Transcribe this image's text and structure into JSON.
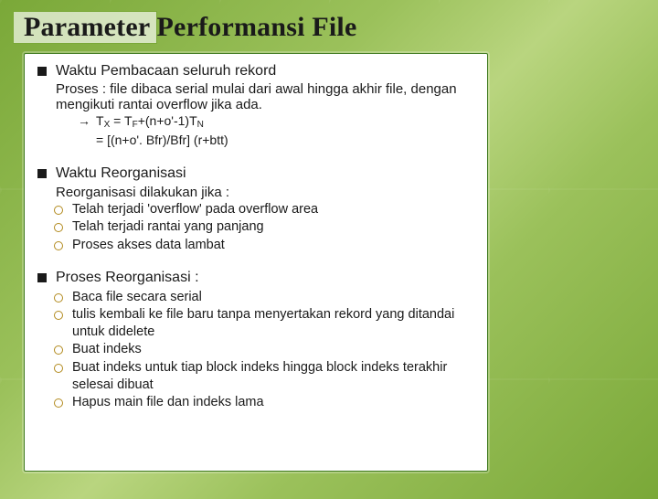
{
  "title": "Parameter Performansi File",
  "section1": {
    "heading": "Waktu Pembacaan seluruh rekord",
    "desc": "Proses : file dibaca serial mulai dari awal hingga akhir file, dengan mengikuti rantai overflow jika ada.",
    "eq_arrow": "→",
    "eq1_lhs": "T",
    "eq1_sub1": "X",
    "eq1_mid": " = T",
    "eq1_sub2": "F",
    "eq1_tail1": "+(n+o'-1)T",
    "eq1_sub3": "N",
    "eq2": "= [(n+o'. Bfr)/Bfr] (r+btt)"
  },
  "section2": {
    "heading": "Waktu Reorganisasi",
    "desc": "Reorganisasi dilakukan jika :",
    "items": [
      "Telah terjadi 'overflow' pada overflow area",
      "Telah terjadi rantai yang panjang",
      "Proses akses data lambat"
    ]
  },
  "section3": {
    "heading": "Proses Reorganisasi :",
    "items": [
      "Baca file secara serial",
      "tulis kembali ke file baru tanpa menyertakan rekord yang ditandai untuk didelete",
      "Buat indeks",
      "Buat indeks untuk tiap block indeks hingga block indeks terakhir selesai dibuat",
      "Hapus main file dan indeks lama"
    ]
  }
}
